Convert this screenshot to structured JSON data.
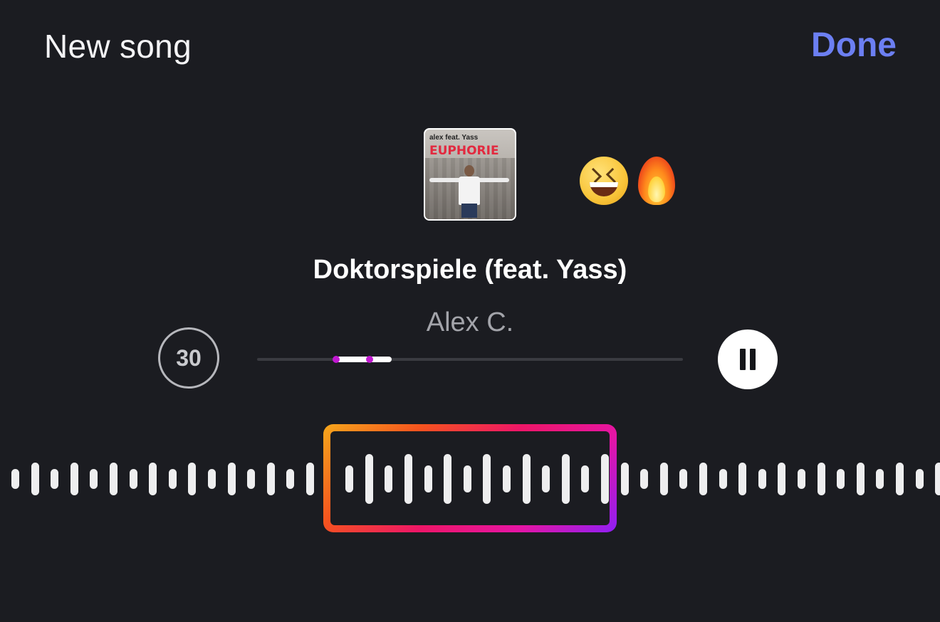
{
  "header": {
    "title": "New song",
    "done_label": "Done"
  },
  "album": {
    "cover_title": "EUPHORIE",
    "cover_subtitle": "alex feat. Yass"
  },
  "emojis": {
    "items": [
      "grinning-squinting-face-icon",
      "fire-icon"
    ]
  },
  "track": {
    "title": "Doktorspiele (feat. Yass)",
    "artist": "Alex C."
  },
  "controls": {
    "clip_duration": "30",
    "playback_state": "playing",
    "progress_start_fraction": 0.186,
    "progress_end_fraction": 0.316
  },
  "colors": {
    "background": "#1b1c21",
    "accent_done": "#6c7ff2",
    "selection_gradient": [
      "#f6a81c",
      "#f5531e",
      "#ee1667",
      "#e515a4",
      "#8e1ff5"
    ]
  }
}
